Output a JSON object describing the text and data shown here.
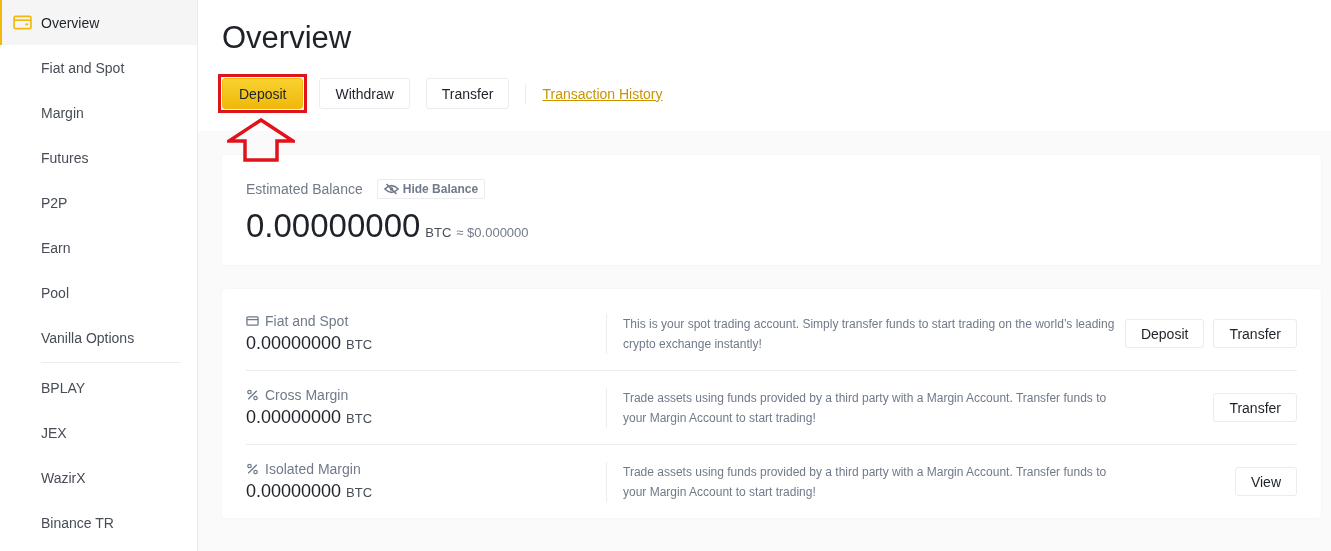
{
  "sidebar": {
    "sections": [
      {
        "items": [
          {
            "label": "Overview",
            "selected": true
          },
          {
            "label": "Fiat and Spot",
            "selected": false
          },
          {
            "label": "Margin",
            "selected": false
          },
          {
            "label": "Futures",
            "selected": false
          },
          {
            "label": "P2P",
            "selected": false
          },
          {
            "label": "Earn",
            "selected": false
          },
          {
            "label": "Pool",
            "selected": false
          },
          {
            "label": "Vanilla Options",
            "selected": false
          }
        ]
      },
      {
        "items": [
          {
            "label": "BPLAY",
            "selected": false
          },
          {
            "label": "JEX",
            "selected": false
          },
          {
            "label": "WazirX",
            "selected": false
          },
          {
            "label": "Binance TR",
            "selected": false
          }
        ]
      }
    ]
  },
  "page_title": "Overview",
  "actions": [
    {
      "label": "Deposit",
      "kind": "primary",
      "highlighted": true
    },
    {
      "label": "Withdraw",
      "kind": "secondary",
      "highlighted": false
    },
    {
      "label": "Transfer",
      "kind": "secondary",
      "highlighted": false
    }
  ],
  "history_link": "Transaction History",
  "balance": {
    "label": "Estimated Balance",
    "hide_button": "Hide Balance",
    "amount": "0.00000000",
    "unit": "BTC",
    "fiat": "≈ $0.000000"
  },
  "accounts": [
    {
      "name": "Fiat and Spot",
      "kind": "wallet",
      "amount": "0.00000000",
      "unit": "BTC",
      "description": "This is your spot trading account. Simply transfer funds to start trading on the world’s leading crypto exchange instantly!",
      "buttons": [
        "Deposit",
        "Transfer"
      ]
    },
    {
      "name": "Cross Margin",
      "kind": "margin",
      "amount": "0.00000000",
      "unit": "BTC",
      "description": "Trade assets using funds provided by a third party with a Margin Account. Transfer funds to your Margin Account to start trading!",
      "buttons": [
        "Transfer"
      ]
    },
    {
      "name": "Isolated Margin",
      "kind": "margin",
      "amount": "0.00000000",
      "unit": "BTC",
      "description": "Trade assets using funds provided by a third party with a Margin Account. Transfer funds to your Margin Account to start trading!",
      "buttons": [
        "View"
      ]
    }
  ]
}
